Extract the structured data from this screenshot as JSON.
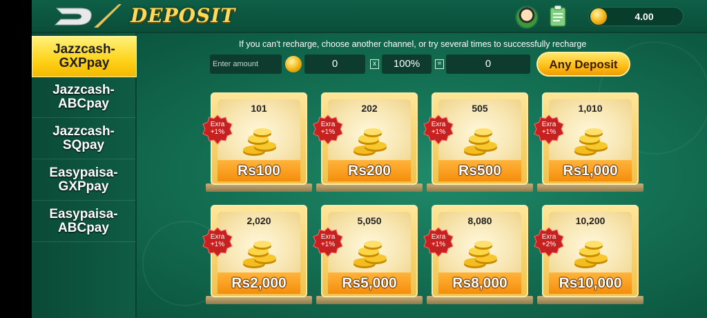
{
  "header": {
    "title": "DEPOSIT",
    "balance": "4.00"
  },
  "sidebar": {
    "items": [
      {
        "label": "Jazzcash-\nGXPpay",
        "active": true
      },
      {
        "label": "Jazzcash-\nABCpay",
        "active": false
      },
      {
        "label": "Jazzcash-\nSQpay",
        "active": false
      },
      {
        "label": "Easypaisa-\nGXPpay",
        "active": false
      },
      {
        "label": "Easypaisa-\nABCpay",
        "active": false
      }
    ]
  },
  "deposit": {
    "notice": "If you can't recharge, choose another channel, or try several times to successfully recharge",
    "amount_label": "Enter amount",
    "amount_value": "0",
    "multiply_symbol": "x",
    "percent": "100%",
    "equals_symbol": "=",
    "result_value": "0",
    "any_deposit_label": "Any Deposit"
  },
  "packages": [
    {
      "coins": "101",
      "extra": "Exra\n+1%",
      "price": "Rs100"
    },
    {
      "coins": "202",
      "extra": "Exra\n+1%",
      "price": "Rs200"
    },
    {
      "coins": "505",
      "extra": "Exra\n+1%",
      "price": "Rs500"
    },
    {
      "coins": "1,010",
      "extra": "Exra\n+1%",
      "price": "Rs1,000"
    },
    {
      "coins": "2,020",
      "extra": "Exra\n+1%",
      "price": "Rs2,000"
    },
    {
      "coins": "5,050",
      "extra": "Exra\n+1%",
      "price": "Rs5,000"
    },
    {
      "coins": "8,080",
      "extra": "Exra\n+1%",
      "price": "Rs8,000"
    },
    {
      "coins": "10,200",
      "extra": "Exra\n+2%",
      "price": "Rs10,000"
    }
  ],
  "colors": {
    "accent": "#ffd21a",
    "badge": "#c62121",
    "price": "#f58d0c",
    "background": "#157255"
  },
  "icons": {
    "logo": "brand-logo",
    "avatar": "avatar-icon",
    "clipboard": "clipboard-icon",
    "coin": "coin-icon"
  }
}
